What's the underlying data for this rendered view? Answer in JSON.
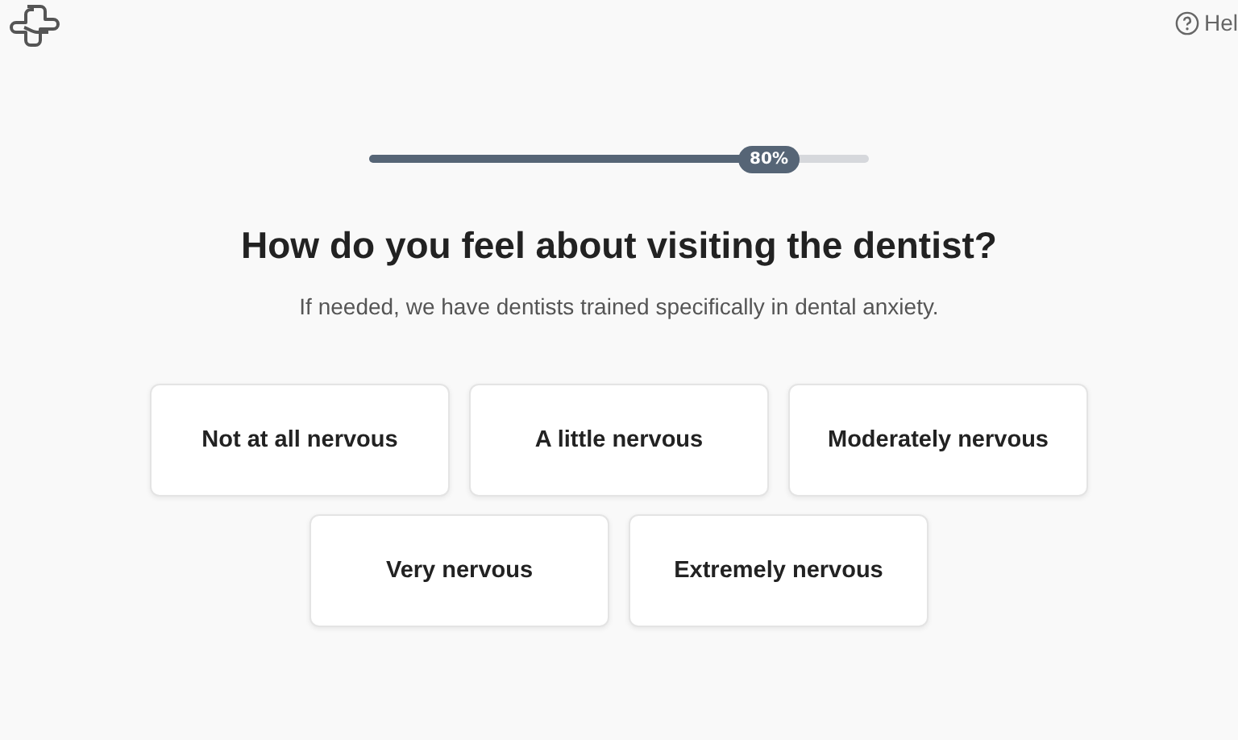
{
  "header": {
    "help_label": "Hel"
  },
  "progress": {
    "level": 0.8,
    "reading": "80%"
  },
  "question": {
    "title": "How do you feel about visiting the dentist?",
    "subtitle": "If needed, we have dentists trained specifically in dental anxiety."
  },
  "options": [
    {
      "label": "Not at all nervous"
    },
    {
      "label": "A little nervous"
    },
    {
      "label": "Moderately nervous"
    },
    {
      "label": "Very nervous"
    },
    {
      "label": "Extremely nervous"
    }
  ]
}
